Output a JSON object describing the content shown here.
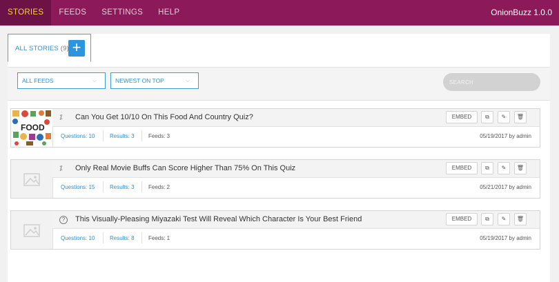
{
  "app": {
    "name": "OnionBuzz 1.0.0",
    "nav": [
      {
        "label": "STORIES",
        "active": true
      },
      {
        "label": "FEEDS",
        "active": false
      },
      {
        "label": "SETTINGS",
        "active": false
      },
      {
        "label": "HELP",
        "active": false
      }
    ],
    "colors": {
      "topbar": "#8c1a5a",
      "active_tab": "#6d1246",
      "active_text": "#f5d33a",
      "accent": "#2e94db"
    }
  },
  "tabs": {
    "all_stories_label": "ALL STORIES",
    "all_stories_count": "(9)",
    "add_icon": "plus-icon"
  },
  "filters": {
    "feeds_value": "ALL FEEDS",
    "sort_value": "NEWEST ON TOP",
    "search_placeholder": "SEARCH"
  },
  "stories": [
    {
      "title": "Can You Get 10/10 On This Food And Country Quiz?",
      "type_icon": "percent-icon",
      "type_glyph": "⁒",
      "thumbnail": "food-collage",
      "questions": "Questions: 10",
      "results": "Results: 3",
      "feeds": "Feeds: 3",
      "date": "05/19/2017 by admin",
      "embed": "EMBED",
      "thumb_text": "FOOD"
    },
    {
      "title": "Only Real Movie Buffs Can Score Higher Than 75% On This Quiz",
      "type_icon": "percent-icon",
      "type_glyph": "⁒",
      "thumbnail": "image-placeholder-icon",
      "questions": "Questions: 15",
      "results": "Results: 3",
      "feeds": "Feeds: 2",
      "date": "05/21/2017 by admin",
      "embed": "EMBED"
    },
    {
      "title": "This Visually-Pleasing Miyazaki Test Will Reveal Which Character Is Your Best Friend",
      "type_icon": "question-circle-icon",
      "type_glyph": "?",
      "thumbnail": "image-placeholder-icon",
      "questions": "Questions: 10",
      "results": "Results: 8",
      "feeds": "Feeds: 1",
      "date": "05/19/2017 by admin",
      "embed": "EMBED"
    }
  ]
}
